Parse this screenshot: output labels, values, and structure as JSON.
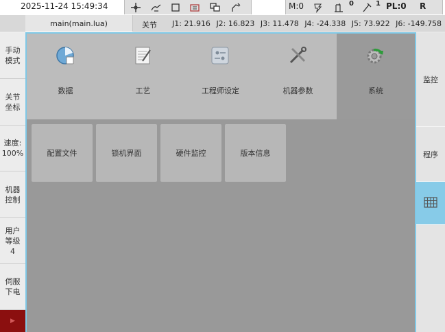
{
  "status": {
    "datetime": "2025-11-24 15:49:34",
    "mode_value": "M:0",
    "speed_count": "0",
    "tool_count": "1",
    "pl": "PL:0",
    "r": "R"
  },
  "toolbar_icons": [
    "crosshair-icon",
    "hand-icon",
    "square-icon",
    "robot-icon",
    "copy-icon",
    "robot-arm-icon"
  ],
  "file": {
    "tab_label": "main(main.lua)"
  },
  "joints": {
    "label": "关节",
    "values": [
      "J1:  21.916",
      "J2:  16.823",
      "J3:  11.478",
      "J4:  -24.338",
      "J5:  73.922",
      "J6:  -149.758"
    ]
  },
  "left_sidebar": {
    "items": [
      "手动\n模式",
      "关节\n坐标",
      "速度:\n100%",
      "机器\n控制",
      "用户\n等级\n4",
      "伺服\n下电"
    ]
  },
  "menu": {
    "items": [
      {
        "label": "数据",
        "icon": "database-icon"
      },
      {
        "label": "工艺",
        "icon": "notepad-icon"
      },
      {
        "label": "工程师设定",
        "icon": "engineer-settings-icon"
      },
      {
        "label": "机器参数",
        "icon": "tools-icon"
      },
      {
        "label": "系统",
        "icon": "gear-refresh-icon"
      }
    ],
    "active_index": 4
  },
  "sub_buttons": [
    "配置文件",
    "锁机界面",
    "硬件监控",
    "版本信息"
  ],
  "right_sidebar": {
    "items": [
      "监控",
      "程序"
    ],
    "grid_icon": "grid-icon"
  },
  "colors": {
    "main_bg": "#999999",
    "menu_bg": "#bcbcbc",
    "accent": "#87cbe8",
    "stop": "#8b0f0f"
  }
}
